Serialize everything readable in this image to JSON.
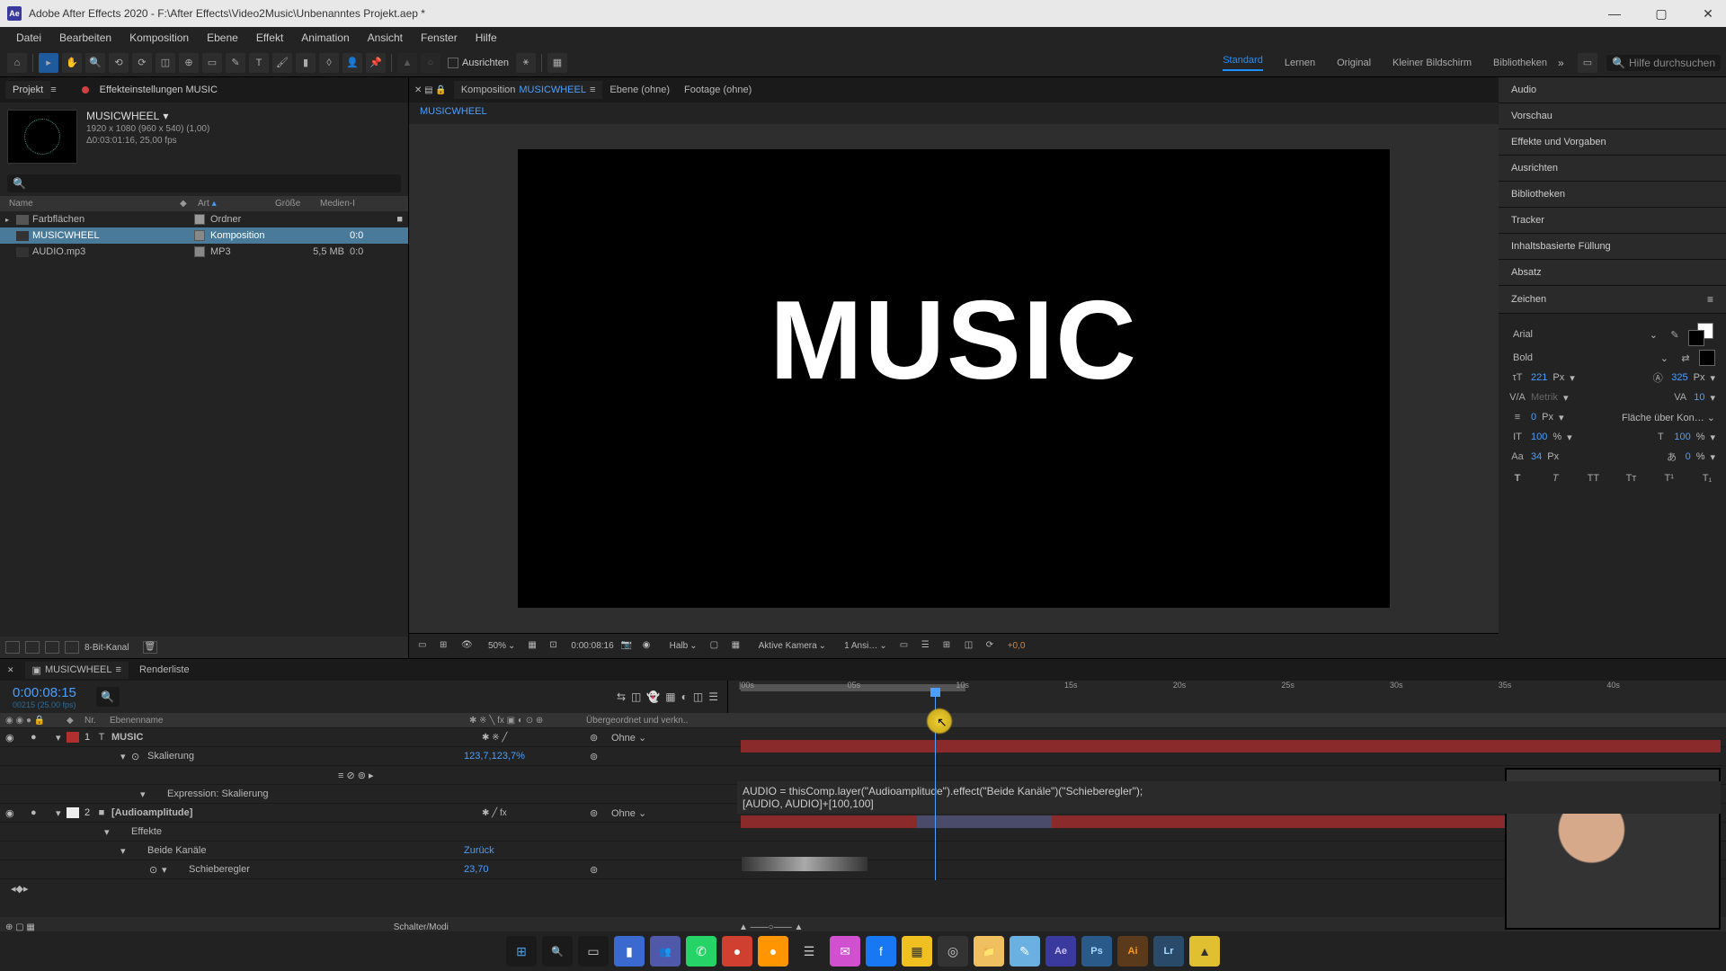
{
  "titlebar": {
    "app": "Ae",
    "title": "Adobe After Effects 2020 - F:\\After Effects\\Video2Music\\Unbenanntes Projekt.aep *"
  },
  "menu": [
    "Datei",
    "Bearbeiten",
    "Komposition",
    "Ebene",
    "Effekt",
    "Animation",
    "Ansicht",
    "Fenster",
    "Hilfe"
  ],
  "toolbar": {
    "align_label": "Ausrichten"
  },
  "workspaces": {
    "items": [
      "Standard",
      "Lernen",
      "Original",
      "Kleiner Bildschirm",
      "Bibliotheken"
    ],
    "active": 0
  },
  "help_search": "Hilfe durchsuchen",
  "project": {
    "tab_project": "Projekt",
    "tab_effects": "Effekteinstellungen  MUSIC",
    "comp_name": "MUSICWHEEL",
    "meta1": "1920 x 1080 (960 x 540) (1,00)",
    "meta2": "Δ0:03:01:16, 25,00 fps",
    "cols": {
      "name": "Name",
      "art": "Art",
      "size": "Größe",
      "media": "Medien-I"
    },
    "rows": [
      {
        "tw": "▸",
        "icon": "folder",
        "name": "Farbflächen",
        "swatch": "#999",
        "type": "Ordner",
        "size": "",
        "dur": "",
        "sel": false,
        "link": "■"
      },
      {
        "tw": "",
        "icon": "comp",
        "name": "MUSICWHEEL",
        "swatch": "#888",
        "type": "Komposition",
        "size": "",
        "dur": "0:0",
        "sel": true,
        "link": ""
      },
      {
        "tw": "",
        "icon": "audio",
        "name": "AUDIO.mp3",
        "swatch": "#888",
        "type": "MP3",
        "size": "5,5 MB",
        "dur": "0:0",
        "sel": false,
        "link": ""
      }
    ],
    "depth_label": "8-Bit-Kanal"
  },
  "viewer": {
    "tab_comp_prefix": "Komposition",
    "tab_comp_name": "MUSICWHEEL",
    "tab_layer": "Ebene  (ohne)",
    "tab_footage": "Footage  (ohne)",
    "flowchart": "MUSICWHEEL",
    "bigtext": "MUSIC",
    "foot": {
      "zoom": "50%",
      "tc": "0:00:08:16",
      "res": "Halb",
      "camera": "Aktive Kamera",
      "views": "1 Ansi…",
      "exp": "+0,0"
    }
  },
  "rightPanels": [
    "Audio",
    "Vorschau",
    "Effekte und Vorgaben",
    "Ausrichten",
    "Bibliotheken",
    "Tracker",
    "Inhaltsbasierte Füllung",
    "Absatz"
  ],
  "char": {
    "title": "Zeichen",
    "font": "Arial",
    "style": "Bold",
    "fill": "#ffffff",
    "stroke": "#000000",
    "size": "221",
    "unit1": "Px",
    "leading": "325",
    "unit2": "Px",
    "kern": "Metrik",
    "track": "10",
    "stroke_w": "0",
    "unit3": "Px",
    "caps": "Fläche über Kon…",
    "scaleV": "100",
    "scaleVu": "%",
    "scaleH": "100",
    "scaleHu": "%",
    "baseline": "34",
    "baselineu": "Px",
    "tsume": "0",
    "tsumeu": "%"
  },
  "timeline": {
    "comp_name": "MUSICWHEEL",
    "tab_render": "Renderliste",
    "timecode": "0:00:08:15",
    "sub": "00215 (25.00 fps)",
    "cols": {
      "nr": "Nr.",
      "layer": "Ebenenname",
      "parent": "Übergeordnet und verkn.."
    },
    "layers": [
      {
        "nr": "1",
        "name": "MUSIC",
        "parent": "Ohne",
        "badge": "#b03030",
        "icon": "T"
      },
      {
        "prop": true,
        "name": "Skalierung",
        "val": "123,7,123,7%",
        "blue": true
      },
      {
        "prop": true,
        "name": "Expression: Skalierung"
      },
      {
        "nr": "2",
        "name": "[Audioamplitude]",
        "parent": "Ohne",
        "badge": "#eeeeee",
        "icon": "■"
      },
      {
        "prop": true,
        "name": "Effekte"
      },
      {
        "prop": true,
        "name": "Beide Kanäle",
        "val": "Zurück",
        "blue": true
      },
      {
        "prop": true,
        "name": "Schieberegler",
        "val": "23,70",
        "blue": true
      }
    ],
    "expression_l1": "AUDIO = thisComp.layer(\"Audioamplitude\").effect(\"Beide Kanäle\")(\"Schieberegler\");",
    "expression_l2": "[AUDIO, AUDIO]+[100,100]",
    "ruler": [
      "|00s",
      "05s",
      "10s",
      "15s",
      "20s",
      "25s",
      "30s",
      "35s",
      "40s"
    ],
    "switch_label": "Schalter/Modi"
  },
  "taskbar": [
    {
      "name": "start",
      "bg": "#1a1a1a",
      "glyph": "⊞",
      "color": "#4aa0e8"
    },
    {
      "name": "search",
      "bg": "#1a1a1a",
      "glyph": "🔍",
      "color": "#ccc"
    },
    {
      "name": "taskview",
      "bg": "#1a1a1a",
      "glyph": "▭",
      "color": "#ccc"
    },
    {
      "name": "explorer",
      "bg": "#3a6ad0",
      "glyph": "▮",
      "color": "#fff"
    },
    {
      "name": "teams",
      "bg": "#5058aa",
      "glyph": "👥",
      "color": "#fff"
    },
    {
      "name": "whatsapp",
      "bg": "#25d366",
      "glyph": "✆",
      "color": "#fff"
    },
    {
      "name": "app-red",
      "bg": "#d04030",
      "glyph": "●",
      "color": "#fff"
    },
    {
      "name": "firefox",
      "bg": "#ff9500",
      "glyph": "●",
      "color": "#fff"
    },
    {
      "name": "app-dark",
      "bg": "#222",
      "glyph": "☰",
      "color": "#ccc"
    },
    {
      "name": "messenger",
      "bg": "#d050d0",
      "glyph": "✉",
      "color": "#fff"
    },
    {
      "name": "facebook",
      "bg": "#1877f2",
      "glyph": "f",
      "color": "#fff"
    },
    {
      "name": "notes",
      "bg": "#f0c020",
      "glyph": "▦",
      "color": "#333"
    },
    {
      "name": "obs",
      "bg": "#333",
      "glyph": "◎",
      "color": "#ccc"
    },
    {
      "name": "files",
      "bg": "#f0c060",
      "glyph": "📁",
      "color": "#333"
    },
    {
      "name": "notepad",
      "bg": "#6ab0e0",
      "glyph": "✎",
      "color": "#fff"
    },
    {
      "name": "aftereffects",
      "bg": "#3a3a9e",
      "glyph": "Ae",
      "color": "#cac0ff"
    },
    {
      "name": "photoshop",
      "bg": "#2a5a8a",
      "glyph": "Ps",
      "color": "#a8d8ff"
    },
    {
      "name": "illustrator",
      "bg": "#5a3a1a",
      "glyph": "Ai",
      "color": "#ff9a00"
    },
    {
      "name": "lightroom",
      "bg": "#2a4a6a",
      "glyph": "Lr",
      "color": "#a8d8ff"
    },
    {
      "name": "app-yellow",
      "bg": "#e0c030",
      "glyph": "▲",
      "color": "#333"
    }
  ]
}
